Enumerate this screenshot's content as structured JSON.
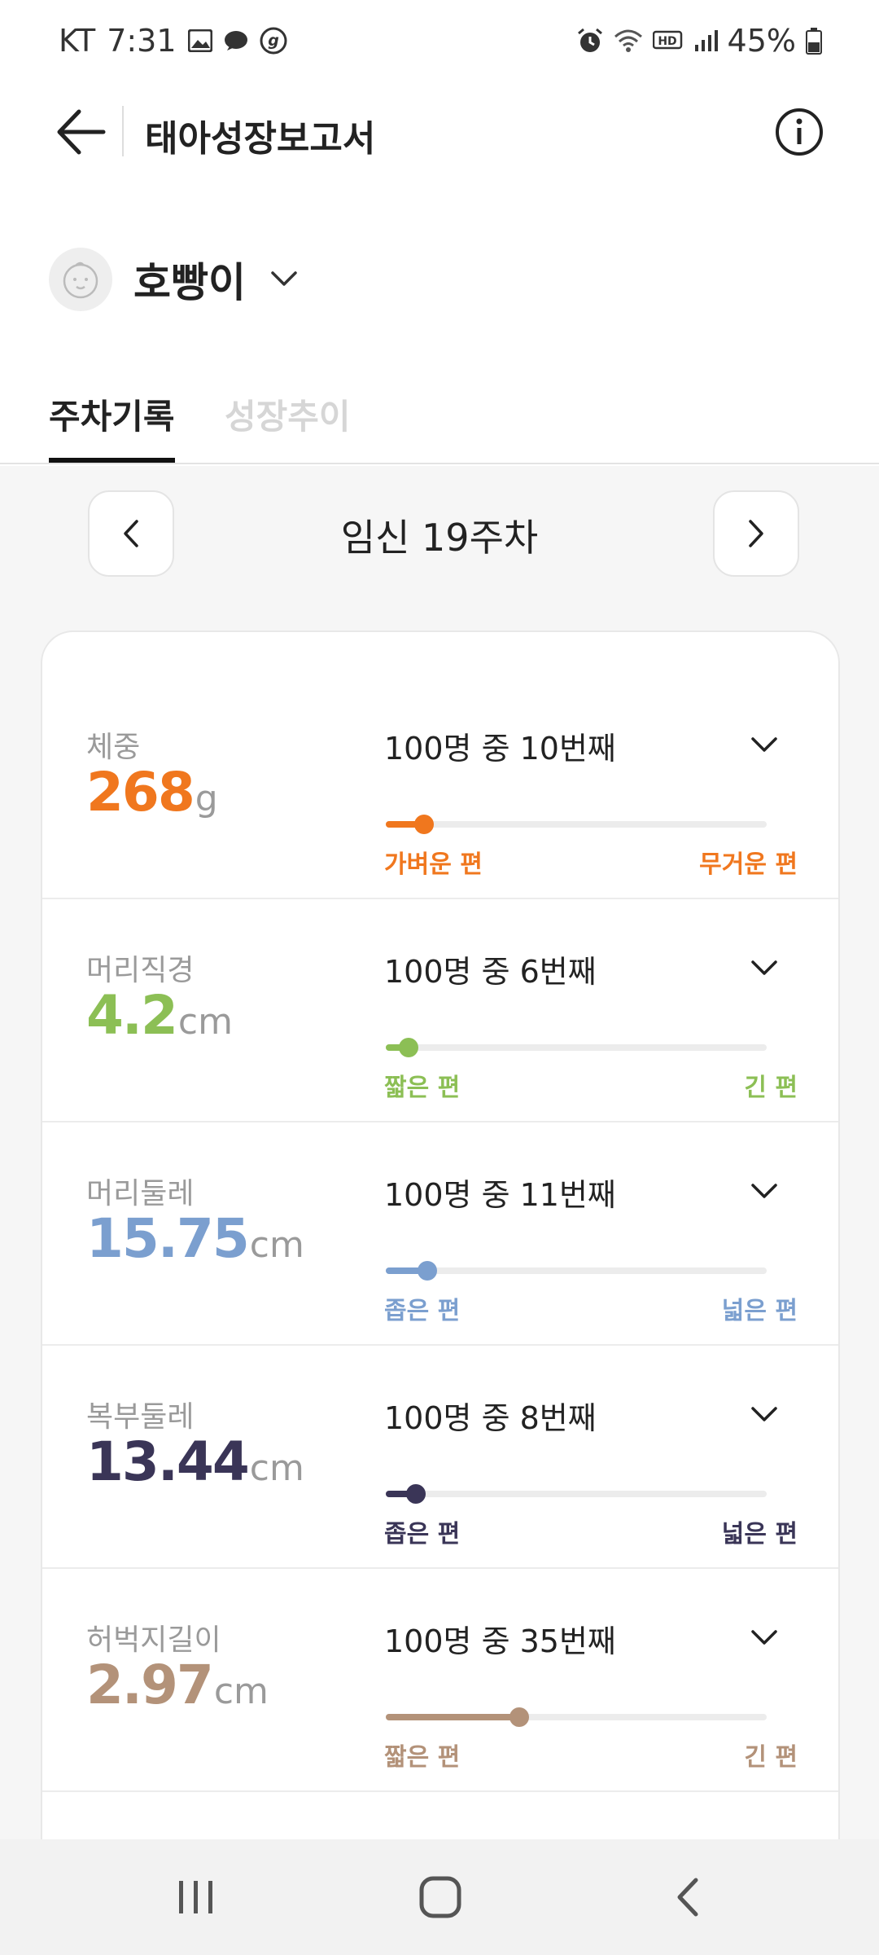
{
  "status_bar": {
    "carrier": "KT",
    "time": "7:31",
    "battery": "45%",
    "left_icons": [
      "gallery-icon",
      "chat-bubble-icon",
      "g-app-icon"
    ],
    "right_icons": [
      "alarm-icon",
      "wifi-icon",
      "hd-voice-icon",
      "signal-icon",
      "battery-icon"
    ]
  },
  "app_bar": {
    "title": "태아성장보고서"
  },
  "baby": {
    "name": "호빵이"
  },
  "tabs": [
    {
      "label": "주차기록",
      "active": true
    },
    {
      "label": "성장추이",
      "active": false
    }
  ],
  "week": {
    "label": "임신 19주차"
  },
  "metrics": [
    {
      "name": "체중",
      "value": "268",
      "unit": "g",
      "rank": "100명 중 10번째",
      "percent": 10,
      "low": "가벼운 편",
      "high": "무거운 편",
      "color": "#F0771E"
    },
    {
      "name": "머리직경",
      "value": "4.2",
      "unit": "cm",
      "rank": "100명 중 6번째",
      "percent": 6,
      "low": "짧은 편",
      "high": "긴 편",
      "color": "#8CBF55"
    },
    {
      "name": "머리둘레",
      "value": "15.75",
      "unit": "cm",
      "rank": "100명 중 11번째",
      "percent": 11,
      "low": "좁은 편",
      "high": "넓은 편",
      "color": "#7B9FCF"
    },
    {
      "name": "복부둘레",
      "value": "13.44",
      "unit": "cm",
      "rank": "100명 중 8번째",
      "percent": 8,
      "low": "좁은 편",
      "high": "넓은 편",
      "color": "#3A3557"
    },
    {
      "name": "허벅지길이",
      "value": "2.97",
      "unit": "cm",
      "rank": "100명 중 35번째",
      "percent": 35,
      "low": "짧은 편",
      "high": "긴 편",
      "color": "#B39279"
    }
  ],
  "colors": {
    "content_bg": "#F6F6F6",
    "divider": "#ECECEC"
  }
}
